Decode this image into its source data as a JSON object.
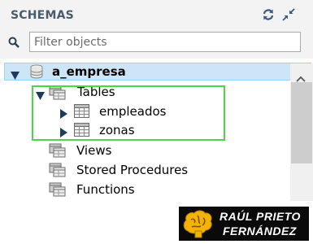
{
  "sidebar": {
    "title": "SCHEMAS",
    "refresh_icon": "refresh-icon",
    "collapse_icon": "collapse-icon",
    "filter": {
      "placeholder": "Filter objects",
      "value": "",
      "icon": "search-icon"
    },
    "tree": {
      "schema": {
        "label": "a_empresa",
        "expanded": true,
        "selected": true,
        "icon": "database-icon"
      },
      "tables": {
        "label": "Tables",
        "expanded": true,
        "icon": "tables-folder-icon",
        "items": [
          {
            "label": "empleados",
            "expanded": false,
            "icon": "table-icon"
          },
          {
            "label": "zonas",
            "expanded": false,
            "icon": "table-icon"
          }
        ]
      },
      "views": {
        "label": "Views",
        "icon": "views-folder-icon"
      },
      "stored_procedures": {
        "label": "Stored Procedures",
        "icon": "procedures-folder-icon"
      },
      "functions": {
        "label": "Functions",
        "icon": "functions-folder-icon"
      }
    }
  },
  "highlight_color": "#4ed64a",
  "selection_color": "#cde6f7",
  "brand": {
    "line1": "RAÚL PRIETO",
    "line2": "FERNÁNDEZ",
    "icon": "brain-logo-icon",
    "background": "#0a0a0a"
  }
}
